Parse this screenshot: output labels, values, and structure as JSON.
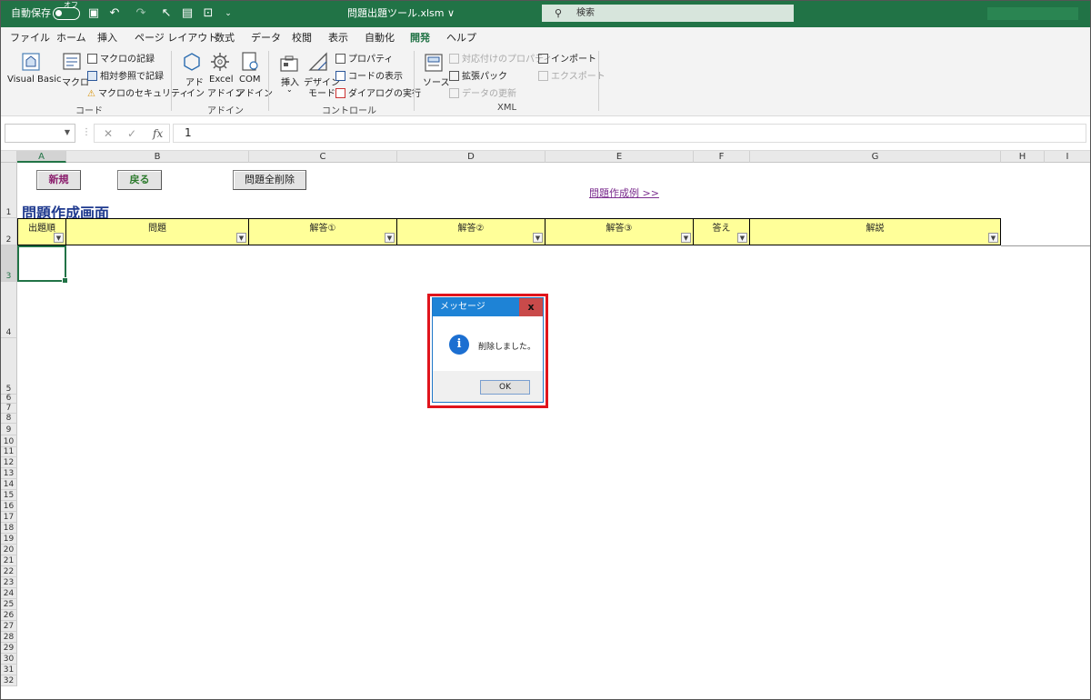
{
  "titlebar": {
    "autosave_label": "自動保存",
    "autosave_state": "オフ",
    "filename": "問題出題ツール.xlsm ∨",
    "search_placeholder": "検索"
  },
  "tabs": [
    "ファイル",
    "ホーム",
    "挿入",
    "ページ レイアウト",
    "数式",
    "データ",
    "校閲",
    "表示",
    "自動化",
    "開発",
    "ヘルプ"
  ],
  "active_tab": "開発",
  "ribbon": {
    "code": {
      "visual_basic": "Visual Basic",
      "macro": "マクロ",
      "record_macro": "マクロの記録",
      "relative_ref": "相対参照で記録",
      "macro_security": "マクロのセキュリティ",
      "label": "コード"
    },
    "addin": {
      "addin1": "アド",
      "addin2": "イン",
      "excel1": "Excel",
      "excel2": "アドイン",
      "com1": "COM",
      "com2": "アドイン",
      "label": "アドイン"
    },
    "controls": {
      "insert": "挿入",
      "design1": "デザイン",
      "design2": "モード",
      "properties": "プロパティ",
      "view_code": "コードの表示",
      "run_dialog": "ダイアログの実行",
      "label": "コントロール"
    },
    "xml": {
      "source": "ソース",
      "map_props": "対応付けのプロパティ",
      "expansion": "拡張パック",
      "refresh": "データの更新",
      "import": "インポート",
      "export": "エクスポート",
      "label": "XML"
    }
  },
  "formula_bar": {
    "name_box": "",
    "cancel": "✕",
    "enter": "✓",
    "fx": "fx",
    "value": "1"
  },
  "columns": [
    "A",
    "B",
    "C",
    "D",
    "E",
    "F",
    "G",
    "H",
    "I"
  ],
  "rows": [
    "1",
    "2",
    "3",
    "4",
    "5",
    "6",
    "7",
    "8",
    "9",
    "10",
    "11",
    "12",
    "13",
    "14",
    "15",
    "16",
    "17",
    "18",
    "19",
    "20",
    "21",
    "22",
    "23",
    "24",
    "25",
    "26",
    "27",
    "28",
    "29",
    "30",
    "31",
    "32"
  ],
  "sheet": {
    "btn_new": "新規",
    "btn_back": "戻る",
    "btn_delete_all": "問題全削除",
    "link_example": "問題作成例 >>",
    "title": "問題作成画面",
    "headers": [
      "出題順",
      "問題",
      "解答①",
      "解答②",
      "解答③",
      "答え",
      "解説"
    ]
  },
  "dialog": {
    "title": "メッセージ",
    "close": "x",
    "message": "削除しました。",
    "ok": "OK"
  },
  "colors": {
    "excel_green": "#217346",
    "header_yellow": "#ffff99",
    "dialog_blue": "#1e83d6",
    "highlight_red": "#e0141c"
  }
}
